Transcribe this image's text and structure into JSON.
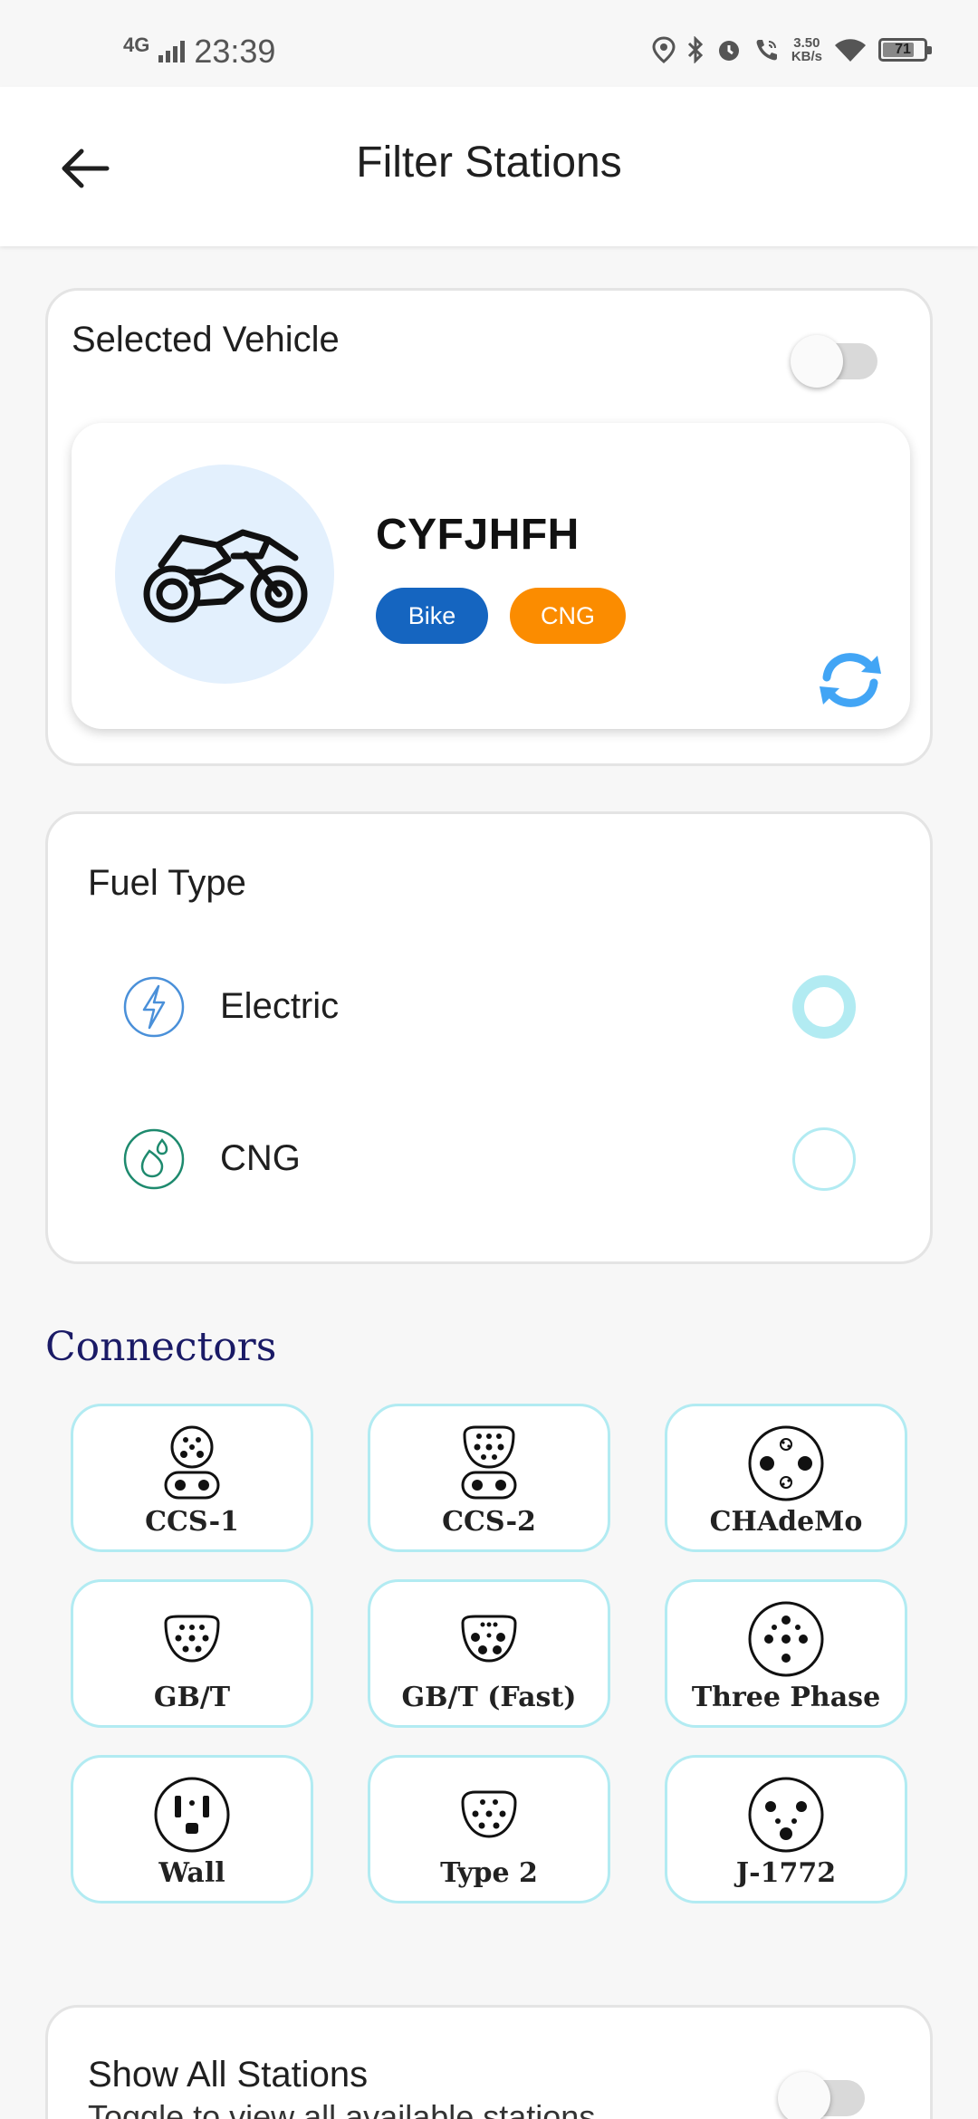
{
  "status_bar": {
    "network": "4G",
    "time": "23:39",
    "speed_value": "3.50",
    "speed_unit": "KB/s",
    "battery": "71"
  },
  "app_bar": {
    "title": "Filter Stations",
    "back_icon": "arrow-left-icon"
  },
  "vehicle_section": {
    "title": "Selected Vehicle",
    "toggle_on": false,
    "vehicle": {
      "name": "CYFJHFH",
      "icon": "motorbike-icon",
      "type_chip": "Bike",
      "fuel_chip": "CNG"
    },
    "refresh_icon": "sync-icon"
  },
  "fuel_section": {
    "title": "Fuel Type",
    "options": [
      {
        "label": "Electric",
        "icon": "lightning-bolt-icon",
        "selected": true
      },
      {
        "label": "CNG",
        "icon": "gas-drop-icon",
        "selected": false
      }
    ]
  },
  "connectors": {
    "title": "Connectors",
    "items": [
      {
        "label": "CCS-1",
        "icon": "ccs1-plug-icon"
      },
      {
        "label": "CCS-2",
        "icon": "ccs2-plug-icon"
      },
      {
        "label": "CHAdeMo",
        "icon": "chademo-plug-icon"
      },
      {
        "label": "GB/T",
        "icon": "gbt-plug-icon"
      },
      {
        "label": "GB/T (Fast)",
        "icon": "gbt-fast-plug-icon"
      },
      {
        "label": "Three Phase",
        "icon": "three-phase-plug-icon"
      },
      {
        "label": "Wall",
        "icon": "wall-socket-icon"
      },
      {
        "label": "Type 2",
        "icon": "type2-plug-icon"
      },
      {
        "label": "J-1772",
        "icon": "j1772-plug-icon"
      }
    ]
  },
  "show_all": {
    "title": "Show All Stations",
    "subtitle": "Toggle to view all available stations",
    "toggle_on": false
  },
  "colors": {
    "primary_blue": "#1565c0",
    "cng_orange": "#fb8c00",
    "accent_cyan": "#b2ebf2",
    "refresh_blue": "#42a5f5",
    "connectors_title": "#1a1a66"
  }
}
